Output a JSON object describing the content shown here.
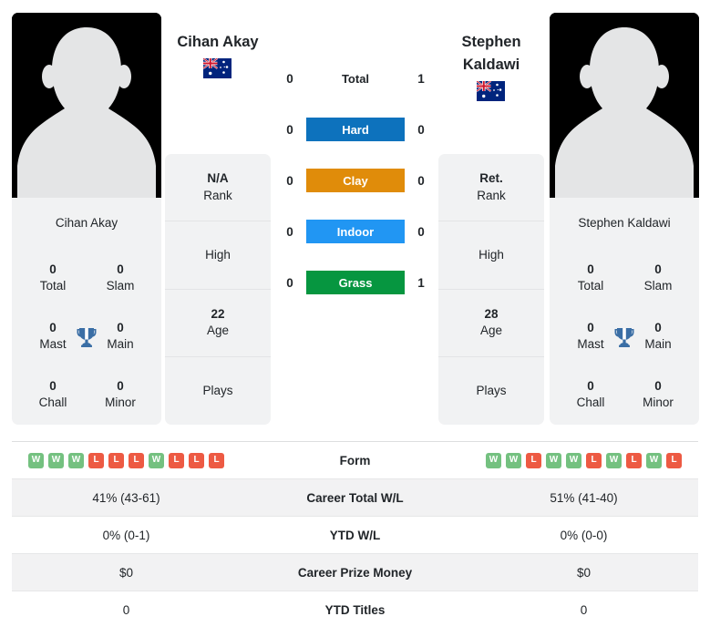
{
  "players": {
    "left": {
      "name": "Cihan Akay",
      "card_name": "Cihan Akay",
      "flag": "australia-flag",
      "rank": "N/A",
      "rank_label": "Rank",
      "high_label": "High",
      "high_value": "",
      "age": "22",
      "age_label": "Age",
      "plays_label": "Plays",
      "plays_value": "",
      "titles": {
        "total": "0",
        "total_label": "Total",
        "slam": "0",
        "slam_label": "Slam",
        "mast": "0",
        "mast_label": "Mast",
        "main": "0",
        "main_label": "Main",
        "chall": "0",
        "chall_label": "Chall",
        "minor": "0",
        "minor_label": "Minor"
      },
      "form": [
        "W",
        "W",
        "W",
        "L",
        "L",
        "L",
        "W",
        "L",
        "L",
        "L"
      ],
      "career_total_wl": "41% (43-61)",
      "ytd_wl": "0% (0-1)",
      "career_prize_money": "$0",
      "ytd_titles": "0"
    },
    "right": {
      "name": "Stephen Kaldawi",
      "card_name": "Stephen Kaldawi",
      "flag": "australia-flag",
      "rank": "Ret.",
      "rank_label": "Rank",
      "high_label": "High",
      "high_value": "",
      "age": "28",
      "age_label": "Age",
      "plays_label": "Plays",
      "plays_value": "",
      "titles": {
        "total": "0",
        "total_label": "Total",
        "slam": "0",
        "slam_label": "Slam",
        "mast": "0",
        "mast_label": "Mast",
        "main": "0",
        "main_label": "Main",
        "chall": "0",
        "chall_label": "Chall",
        "minor": "0",
        "minor_label": "Minor"
      },
      "form": [
        "W",
        "W",
        "L",
        "W",
        "W",
        "L",
        "W",
        "L",
        "W",
        "L"
      ],
      "career_total_wl": "51% (41-40)",
      "ytd_wl": "0% (0-0)",
      "career_prize_money": "$0",
      "ytd_titles": "0"
    }
  },
  "head_to_head": {
    "surfaces": [
      {
        "label": "Total",
        "left": "0",
        "right": "1",
        "color": "",
        "plain": true
      },
      {
        "label": "Hard",
        "left": "0",
        "right": "0",
        "color": "#0d72bd",
        "plain": false
      },
      {
        "label": "Clay",
        "left": "0",
        "right": "0",
        "color": "#e08c0a",
        "plain": false
      },
      {
        "label": "Indoor",
        "left": "0",
        "right": "0",
        "color": "#2196f3",
        "plain": false
      },
      {
        "label": "Grass",
        "left": "0",
        "right": "1",
        "color": "#069640",
        "plain": false
      }
    ]
  },
  "table": {
    "rows": [
      {
        "label": "Form",
        "key": "form",
        "type": "form"
      },
      {
        "label": "Career Total W/L",
        "key": "career_total_wl",
        "type": "text"
      },
      {
        "label": "YTD W/L",
        "key": "ytd_wl",
        "type": "text"
      },
      {
        "label": "Career Prize Money",
        "key": "career_prize_money",
        "type": "text"
      },
      {
        "label": "YTD Titles",
        "key": "ytd_titles",
        "type": "text"
      }
    ]
  },
  "colors": {
    "win_badge": "#74c180",
    "loss_badge": "#ed5a43",
    "card_bg": "#f1f2f3",
    "trophy": "#3a6ea5"
  }
}
